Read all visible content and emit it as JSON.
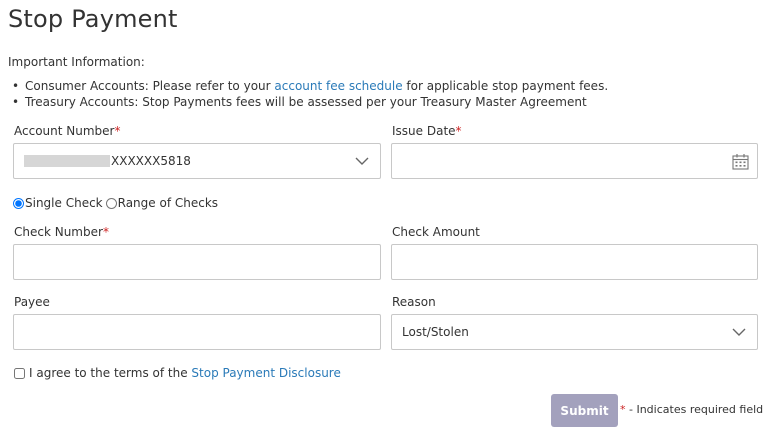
{
  "page": {
    "title": "Stop Payment"
  },
  "info": {
    "heading": "Important Information:",
    "consumer_prefix": "Consumer Accounts: Please refer to your ",
    "consumer_link": "account fee schedule",
    "consumer_suffix": " for applicable stop payment fees.",
    "treasury": "Treasury Accounts: Stop Payments fees will be assessed per your Treasury Master Agreement"
  },
  "form": {
    "account_number": {
      "label": "Account Number",
      "value": "XXXXXX5818"
    },
    "issue_date": {
      "label": "Issue Date",
      "value": "",
      "icon": "calendar-icon"
    },
    "check_mode": {
      "single": "Single Check",
      "range": "Range of Checks",
      "selected": "single"
    },
    "check_number": {
      "label": "Check Number",
      "value": ""
    },
    "check_amount": {
      "label": "Check Amount",
      "value": ""
    },
    "payee": {
      "label": "Payee",
      "value": ""
    },
    "reason": {
      "label": "Reason",
      "value": "Lost/Stolen"
    },
    "agree": {
      "prefix": "I agree to the terms of the ",
      "link": "Stop Payment Disclosure",
      "checked": false
    },
    "required_marker": "*"
  },
  "actions": {
    "submit": "Submit",
    "required_note": " - Indicates required field"
  },
  "colors": {
    "link": "#2a7ab8",
    "required": "#cc2222",
    "submit_bg": "#a3a1bd",
    "border": "#c8c8c8"
  }
}
